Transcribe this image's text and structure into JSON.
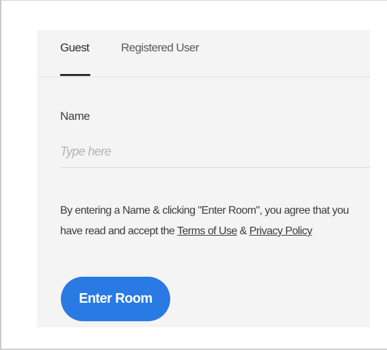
{
  "tabs": [
    {
      "label": "Guest",
      "active": true
    },
    {
      "label": "Registered User",
      "active": false
    }
  ],
  "form": {
    "name_label": "Name",
    "name_placeholder": "Type here",
    "name_value": ""
  },
  "consent": {
    "text_before": "By entering a Name & clicking \"Enter Room\", you agree that you have read and accept the ",
    "terms_link": "Terms of Use",
    "separator": " & ",
    "privacy_link": "Privacy Policy"
  },
  "actions": {
    "enter_label": "Enter Room"
  },
  "colors": {
    "accent": "#2a7ae4",
    "panel_background": "#f4f4f4",
    "text": "#3a3a3a",
    "placeholder": "#b3b3b3"
  }
}
